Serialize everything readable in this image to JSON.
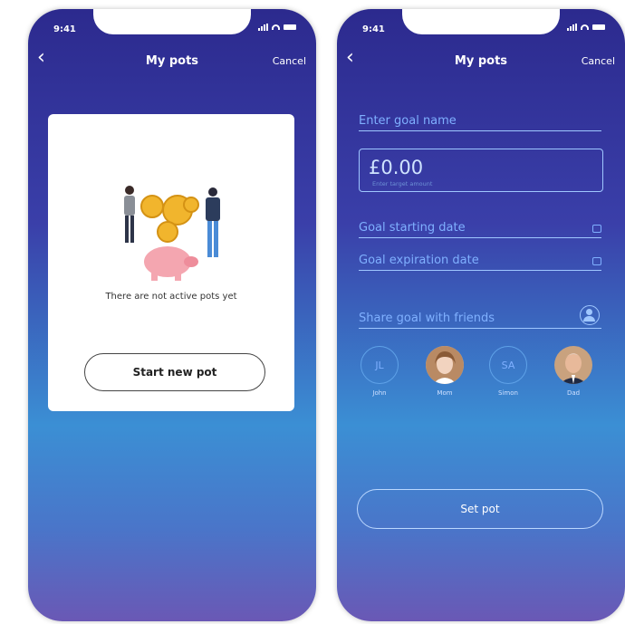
{
  "screens": [
    {
      "status": {
        "time": "9:41"
      },
      "header": {
        "title": "My pots",
        "cancel_label": "Cancel"
      },
      "empty_state": {
        "message": "There are not active pots yet",
        "button_label": "Start new pot"
      }
    },
    {
      "status": {
        "time": "9:41"
      },
      "header": {
        "title": "My pots",
        "cancel_label": "Cancel"
      },
      "form": {
        "goal_name_placeholder": "Enter goal name",
        "amount_value": "£0.00",
        "amount_placeholder": "Enter target amount",
        "start_date_placeholder": "Goal starting date",
        "expiration_date_placeholder": "Goal expiration date",
        "share_label": "Share goal with friends"
      },
      "friends": [
        {
          "initials": "JL",
          "name": "John"
        },
        {
          "initials": "",
          "name": "Mom"
        },
        {
          "initials": "SA",
          "name": "Simon"
        },
        {
          "initials": "",
          "name": "Dad"
        }
      ],
      "submit_label": "Set pot"
    }
  ],
  "colors": {
    "background_top": "#2c2a8e",
    "background_mid": "#3b8fd4",
    "field_text": "#7fb0ff"
  }
}
